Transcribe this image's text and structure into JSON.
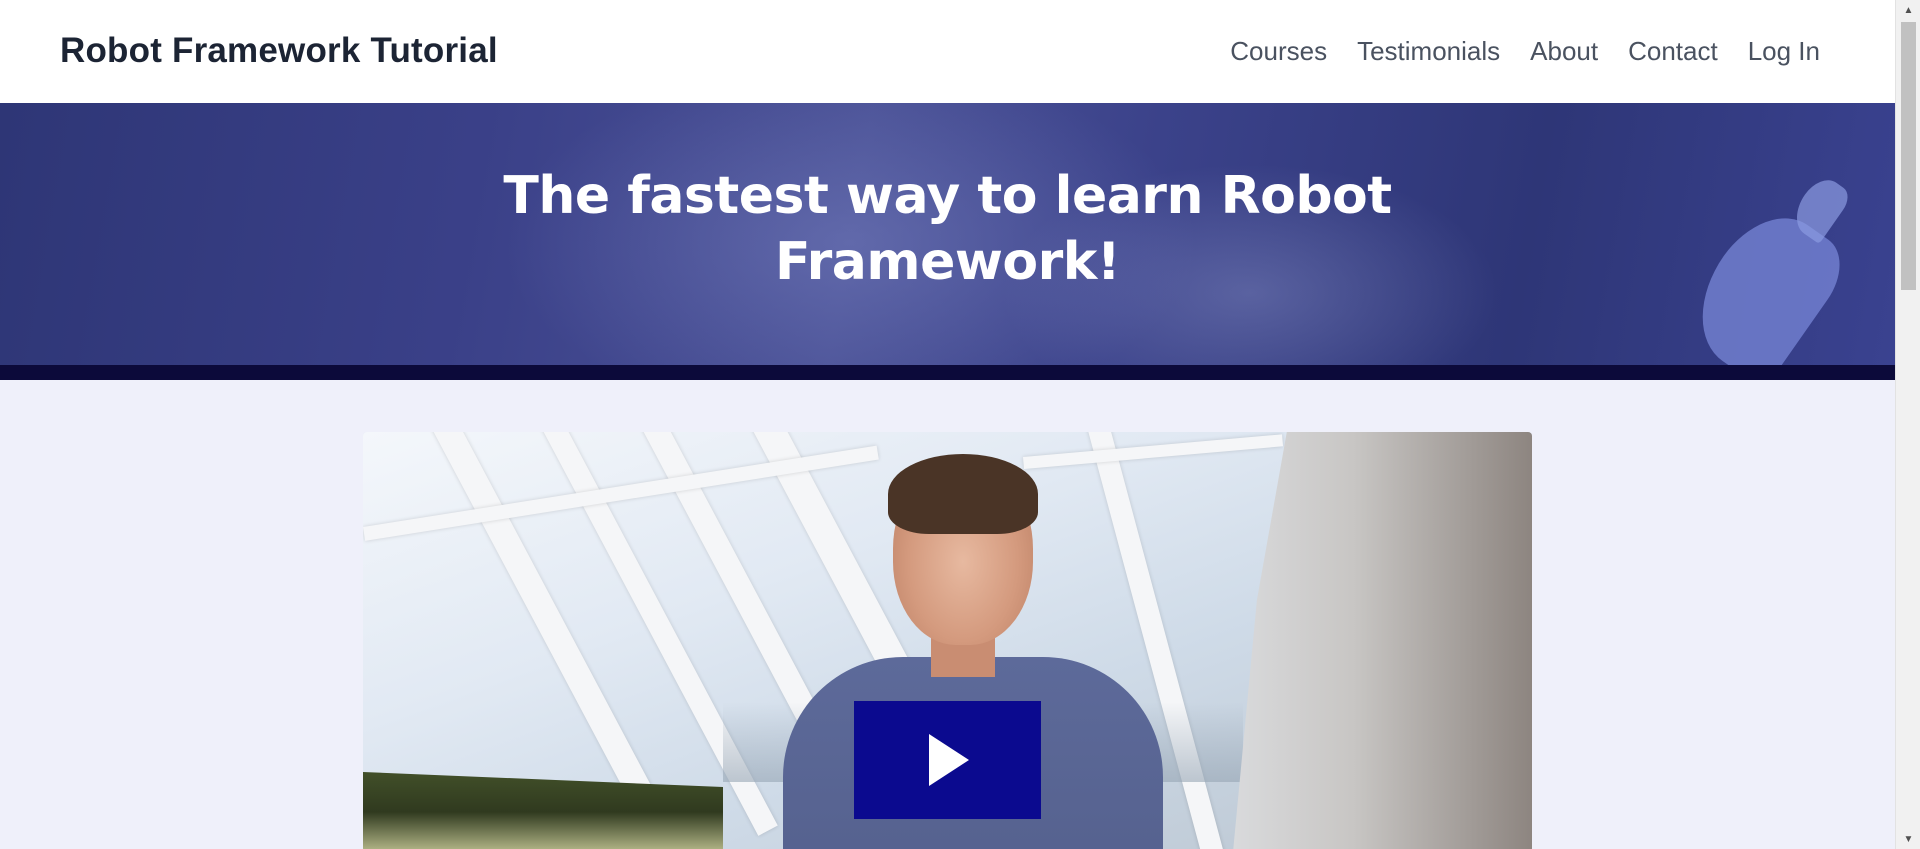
{
  "header": {
    "brand": "Robot Framework Tutorial",
    "nav": [
      {
        "label": "Courses"
      },
      {
        "label": "Testimonials"
      },
      {
        "label": "About"
      },
      {
        "label": "Contact"
      },
      {
        "label": "Log In"
      }
    ]
  },
  "hero": {
    "title_line1": "The fastest way to learn Robot",
    "title_line2": "Framework!"
  },
  "video": {
    "play_icon": "play-icon",
    "play_button_color": "#0b0a8f"
  },
  "scrollbar": {
    "up_icon": "▲",
    "down_icon": "▼"
  },
  "colors": {
    "hero_bg": "#343c7e",
    "hero_bar": "#0c0a3a",
    "page_bg": "#eff0fa",
    "brand_text": "#1c2434",
    "nav_text": "#4a5260"
  }
}
